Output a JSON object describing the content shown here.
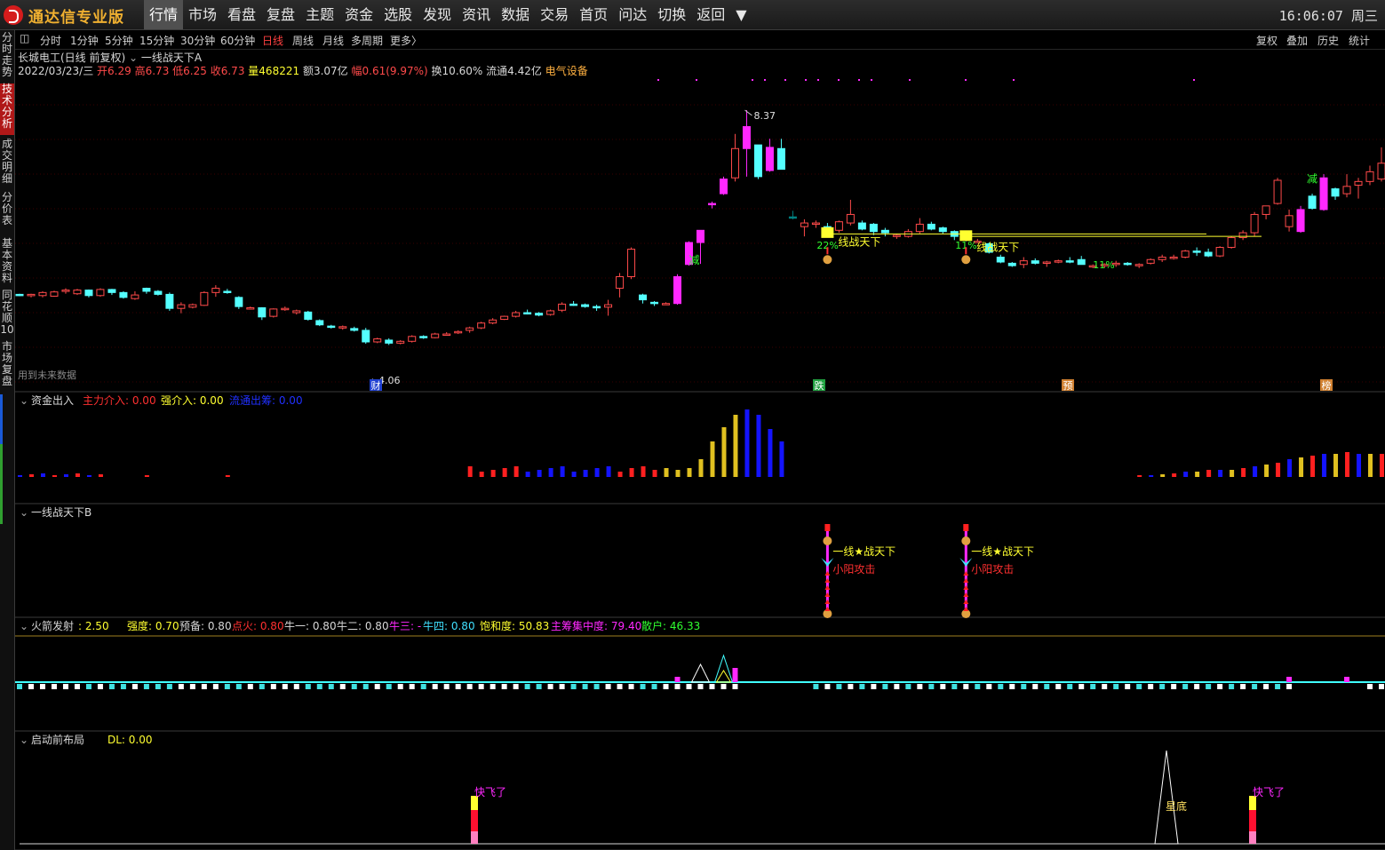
{
  "app": {
    "title": "通达信专业版"
  },
  "menu": [
    "行情",
    "市场",
    "看盘",
    "复盘",
    "主题",
    "资金",
    "选股",
    "发现",
    "资讯",
    "数据",
    "交易",
    "首页",
    "问达",
    "切换",
    "返回",
    "▼"
  ],
  "clock": "16:06:07  周三",
  "sidebar": [
    "分时走势",
    "技术分析",
    "成交明细",
    "分价表",
    "基本资料",
    "同花顺10",
    "市场复盘"
  ],
  "timeframes": [
    "分时",
    "1分钟",
    "5分钟",
    "15分钟",
    "30分钟",
    "60分钟",
    "日线",
    "周线",
    "月线",
    "多周期",
    "更多〉"
  ],
  "right_buttons": [
    "复权",
    "叠加",
    "历史",
    "统计"
  ],
  "stock": {
    "title": "长城电工(日线 前复权)",
    "indicator": "一线战天下A",
    "date": "2022/03/23/三",
    "open": "开6.29",
    "high": "高6.73",
    "low": "低6.25",
    "close": "收6.73",
    "volume": "量468221",
    "amount": "额3.07亿",
    "change": "幅0.61(9.97%)",
    "turnover": "换10.60%",
    "float": "流通4.42亿",
    "sector": "电气设备"
  },
  "main_chart": {
    "high_label": "8.37",
    "low_label": "4.06",
    "note": "用到未来数据",
    "markers": [
      "财",
      "跌",
      "预",
      "榜"
    ],
    "sig_pct": [
      "22%",
      "11%",
      "11%"
    ],
    "sig_text": [
      "线战天下",
      "线战天下"
    ],
    "jian": "减"
  },
  "panel1": {
    "name": "资金出入",
    "f1": "主力介入: 0.00",
    "f2": "强介入: 0.00",
    "f3": "流通出筹: 0.00"
  },
  "panel2": {
    "name": "一线战天下B",
    "sig1": "一线★战天下",
    "sig2": "小阳攻击"
  },
  "panel3": {
    "name": "火箭发射",
    "value": ": 2.50",
    "fields": [
      "强度: 0.70",
      "预备: 0.80",
      "点火: 0.80",
      "牛一: 0.80",
      "牛二: 0.80",
      "牛三: -",
      "牛四: 0.80",
      "饱和度: 50.83",
      "主筹集中度: 79.40",
      "散户: 46.33"
    ]
  },
  "panel4": {
    "name": "启动前布局",
    "dl": "DL: 0.00",
    "kuaifei": "快飞了",
    "xingdi": "星底"
  },
  "colors": {
    "up": "#ff4a4a",
    "down": "#54ffff",
    "magenta": "#ff28ff",
    "yellow": "#ffff30",
    "blue": "#1414ff",
    "teal": "#008080",
    "grid": "#3a0000"
  },
  "chart_data": {
    "type": "candlestick",
    "high": 8.37,
    "low": 4.06,
    "candles": [
      [
        5.35,
        5.36,
        5.32,
        5.34
      ],
      [
        5.34,
        5.36,
        5.3,
        5.35
      ],
      [
        5.33,
        5.4,
        5.3,
        5.38
      ],
      [
        5.32,
        5.41,
        5.31,
        5.39
      ],
      [
        5.4,
        5.45,
        5.36,
        5.42
      ],
      [
        5.36,
        5.44,
        5.34,
        5.42
      ],
      [
        5.42,
        5.43,
        5.3,
        5.33
      ],
      [
        5.33,
        5.45,
        5.31,
        5.43
      ],
      [
        5.43,
        5.44,
        5.34,
        5.38
      ],
      [
        5.38,
        5.4,
        5.28,
        5.3
      ],
      [
        5.28,
        5.4,
        5.26,
        5.34
      ],
      [
        5.45,
        5.46,
        5.36,
        5.4
      ],
      [
        5.4,
        5.42,
        5.33,
        5.35
      ],
      [
        5.35,
        5.38,
        5.08,
        5.12
      ],
      [
        5.12,
        5.22,
        5.04,
        5.18
      ],
      [
        5.14,
        5.2,
        5.12,
        5.18
      ],
      [
        5.17,
        5.4,
        5.16,
        5.38
      ],
      [
        5.38,
        5.5,
        5.31,
        5.45
      ],
      [
        5.4,
        5.44,
        5.36,
        5.39
      ],
      [
        5.3,
        5.32,
        5.11,
        5.15
      ],
      [
        5.13,
        5.15,
        5.1,
        5.13
      ],
      [
        5.13,
        5.14,
        4.93,
        4.98
      ],
      [
        4.99,
        5.12,
        4.97,
        5.11
      ],
      [
        5.1,
        5.15,
        5.08,
        5.12
      ],
      [
        5.05,
        5.1,
        5.02,
        5.08
      ],
      [
        5.06,
        5.08,
        4.92,
        4.94
      ],
      [
        4.92,
        4.94,
        4.83,
        4.85
      ],
      [
        4.83,
        4.85,
        4.79,
        4.81
      ],
      [
        4.8,
        4.84,
        4.77,
        4.82
      ],
      [
        4.79,
        4.82,
        4.74,
        4.76
      ],
      [
        4.76,
        4.8,
        4.54,
        4.57
      ],
      [
        4.57,
        4.64,
        4.55,
        4.62
      ],
      [
        4.6,
        4.63,
        4.52,
        4.55
      ],
      [
        4.55,
        4.6,
        4.53,
        4.58
      ],
      [
        4.58,
        4.68,
        4.56,
        4.66
      ],
      [
        4.66,
        4.68,
        4.62,
        4.64
      ],
      [
        4.64,
        4.72,
        4.63,
        4.7
      ],
      [
        4.7,
        4.73,
        4.68,
        4.7
      ],
      [
        4.72,
        4.76,
        4.7,
        4.74
      ],
      [
        4.76,
        4.82,
        4.72,
        4.8
      ],
      [
        4.8,
        4.9,
        4.78,
        4.88
      ],
      [
        4.88,
        4.96,
        4.86,
        4.93
      ],
      [
        4.94,
        5.0,
        4.93,
        4.99
      ],
      [
        4.99,
        5.08,
        4.97,
        5.05
      ],
      [
        5.05,
        5.1,
        5.02,
        5.04
      ],
      [
        5.04,
        5.06,
        4.99,
        5.01
      ],
      [
        5.02,
        5.1,
        5.0,
        5.08
      ],
      [
        5.09,
        5.22,
        5.06,
        5.19
      ],
      [
        5.19,
        5.24,
        5.16,
        5.18
      ],
      [
        5.18,
        5.2,
        5.13,
        5.15
      ],
      [
        5.15,
        5.18,
        5.08,
        5.14
      ],
      [
        5.14,
        5.26,
        5.0,
        5.18
      ],
      [
        5.45,
        5.7,
        5.3,
        5.64
      ],
      [
        5.64,
        6.12,
        5.6,
        6.09
      ],
      [
        5.34,
        5.36,
        5.2,
        5.26
      ],
      [
        5.22,
        5.24,
        5.16,
        5.2
      ],
      [
        5.2,
        5.22,
        5.18,
        5.2
      ],
      [
        5.2,
        5.68,
        5.18,
        5.64
      ],
      [
        5.84,
        6.22,
        5.82,
        6.2
      ],
      [
        6.2,
        6.3,
        5.85,
        6.4
      ],
      [
        6.84,
        6.87,
        6.76,
        6.84
      ],
      [
        7.0,
        7.28,
        6.98,
        7.24
      ],
      [
        7.26,
        7.98,
        7.2,
        7.74
      ],
      [
        7.74,
        8.37,
        7.28,
        8.1
      ],
      [
        7.28,
        7.64,
        7.24,
        7.8
      ],
      [
        7.76,
        7.9,
        7.36,
        7.38
      ],
      [
        7.74,
        7.9,
        7.48,
        7.4
      ],
      [
        6.62,
        6.72,
        6.58,
        6.62
      ],
      [
        6.46,
        6.58,
        6.3,
        6.52
      ],
      [
        6.52,
        6.56,
        6.44,
        6.52
      ],
      [
        6.46,
        6.52,
        6.4,
        6.44
      ],
      [
        6.4,
        6.56,
        6.36,
        6.54
      ],
      [
        6.52,
        6.9,
        6.48,
        6.66
      ],
      [
        6.52,
        6.56,
        6.4,
        6.42
      ],
      [
        6.5,
        6.52,
        6.32,
        6.38
      ],
      [
        6.4,
        6.44,
        6.3,
        6.36
      ],
      [
        6.3,
        6.34,
        6.26,
        6.32
      ],
      [
        6.3,
        6.42,
        6.28,
        6.38
      ],
      [
        6.38,
        6.6,
        6.34,
        6.5
      ],
      [
        6.5,
        6.54,
        6.4,
        6.42
      ],
      [
        6.44,
        6.46,
        6.34,
        6.38
      ],
      [
        6.38,
        6.4,
        6.24,
        6.3
      ],
      [
        6.26,
        6.3,
        6.22,
        6.24
      ],
      [
        6.22,
        6.26,
        6.19,
        6.22
      ],
      [
        6.18,
        6.2,
        6.02,
        6.04
      ],
      [
        5.96,
        6.0,
        5.86,
        5.88
      ],
      [
        5.86,
        5.88,
        5.8,
        5.82
      ],
      [
        5.84,
        5.96,
        5.78,
        5.9
      ],
      [
        5.9,
        5.94,
        5.84,
        5.86
      ],
      [
        5.86,
        5.9,
        5.8,
        5.88
      ],
      [
        5.88,
        5.92,
        5.86,
        5.9
      ],
      [
        5.9,
        5.96,
        5.86,
        5.88
      ],
      [
        5.92,
        5.98,
        5.84,
        5.84
      ],
      [
        5.8,
        5.84,
        5.78,
        5.82
      ],
      [
        5.82,
        5.86,
        5.78,
        5.84
      ],
      [
        5.84,
        5.9,
        5.8,
        5.86
      ],
      [
        5.86,
        5.88,
        5.82,
        5.84
      ],
      [
        5.84,
        5.86,
        5.78,
        5.84
      ],
      [
        5.86,
        5.94,
        5.84,
        5.92
      ],
      [
        5.92,
        6.0,
        5.88,
        5.96
      ],
      [
        5.94,
        6.0,
        5.92,
        5.96
      ],
      [
        5.96,
        6.08,
        5.94,
        6.06
      ],
      [
        6.06,
        6.12,
        5.98,
        6.04
      ],
      [
        6.04,
        6.1,
        5.96,
        5.98
      ],
      [
        5.98,
        6.14,
        5.96,
        6.12
      ],
      [
        6.12,
        6.3,
        6.1,
        6.28
      ],
      [
        6.28,
        6.4,
        6.24,
        6.36
      ],
      [
        6.36,
        6.7,
        6.3,
        6.66
      ],
      [
        6.66,
        6.72,
        6.58,
        6.8
      ],
      [
        6.84,
        7.26,
        6.82,
        7.22
      ],
      [
        6.46,
        6.74,
        6.38,
        6.64
      ],
      [
        6.38,
        6.8,
        6.36,
        6.74
      ],
      [
        6.76,
        7.0,
        6.74,
        6.96
      ],
      [
        6.74,
        7.32,
        6.72,
        7.26
      ],
      [
        6.96,
        7.1,
        6.9,
        7.08
      ],
      [
        7.0,
        7.32,
        6.94,
        7.12
      ],
      [
        7.14,
        7.26,
        6.92,
        7.2
      ],
      [
        7.2,
        7.46,
        7.14,
        7.36
      ],
      [
        7.24,
        7.76,
        7.2,
        7.5
      ]
    ]
  }
}
